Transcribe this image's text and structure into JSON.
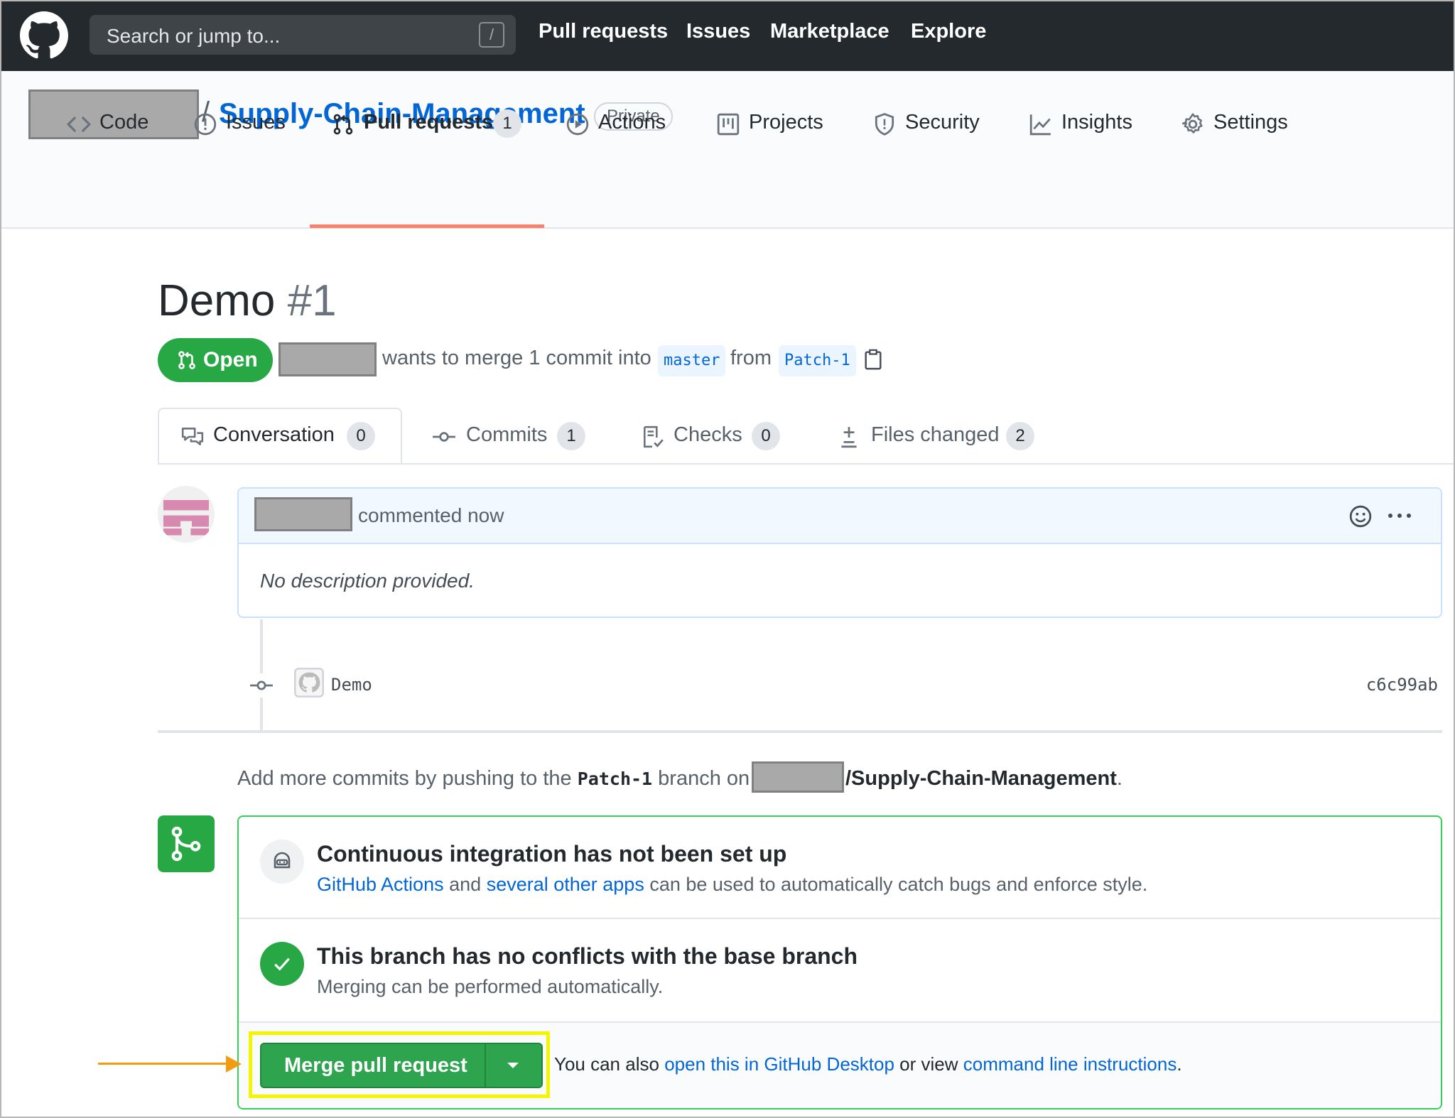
{
  "topbar": {
    "search_placeholder": "Search or jump to...",
    "search_shortcut": "/",
    "nav": [
      "Pull requests",
      "Issues",
      "Marketplace",
      "Explore"
    ]
  },
  "repo": {
    "separator": "/",
    "name": "Supply-Chain-Management",
    "visibility": "Private"
  },
  "tabs": [
    {
      "label": "Code",
      "icon": "code-icon"
    },
    {
      "label": "Issues",
      "icon": "issue-icon"
    },
    {
      "label": "Pull requests",
      "icon": "pull-request-icon",
      "count": "1",
      "selected": true
    },
    {
      "label": "Actions",
      "icon": "play-icon"
    },
    {
      "label": "Projects",
      "icon": "project-icon"
    },
    {
      "label": "Security",
      "icon": "shield-icon"
    },
    {
      "label": "Insights",
      "icon": "graph-icon"
    },
    {
      "label": "Settings",
      "icon": "gear-icon"
    }
  ],
  "pr": {
    "title": "Demo",
    "number": "#1",
    "state": "Open",
    "merge_text": "wants to merge 1 commit into",
    "base_branch": "master",
    "from_text": "from",
    "head_branch": "Patch-1"
  },
  "subtabs": [
    {
      "label": "Conversation",
      "count": "0",
      "icon": "comment-discussion-icon"
    },
    {
      "label": "Commits",
      "count": "1",
      "icon": "git-commit-icon"
    },
    {
      "label": "Checks",
      "count": "0",
      "icon": "checklist-icon"
    },
    {
      "label": "Files changed",
      "count": "2",
      "icon": "diff-icon"
    }
  ],
  "comment": {
    "action": "commented now",
    "body": "No description provided."
  },
  "commit": {
    "message": "Demo",
    "sha": "c6c99ab"
  },
  "push_info": {
    "prefix": "Add more commits by pushing to the",
    "branch": "Patch-1",
    "middle": "branch on",
    "repo": "/Supply-Chain-Management",
    "suffix": "."
  },
  "checks": {
    "ci_title": "Continuous integration has not been set up",
    "ci_link1": "GitHub Actions",
    "ci_and": "and",
    "ci_link2": "several other apps",
    "ci_rest": "can be used to automatically catch bugs and enforce style.",
    "conflict_title": "This branch has no conflicts with the base branch",
    "conflict_sub": "Merging can be performed automatically."
  },
  "merge": {
    "button_label": "Merge pull request",
    "also_text": "You can also",
    "desktop_link": "open this in GitHub Desktop",
    "or_view": "or view",
    "cli_link": "command line instructions",
    "end": "."
  },
  "colors": {
    "topbar": "#24292e",
    "link": "#0366d6",
    "success": "#28a745",
    "tab_underline": "#f9826c",
    "highlight": "#f5f500",
    "arrow": "#f39c12"
  }
}
